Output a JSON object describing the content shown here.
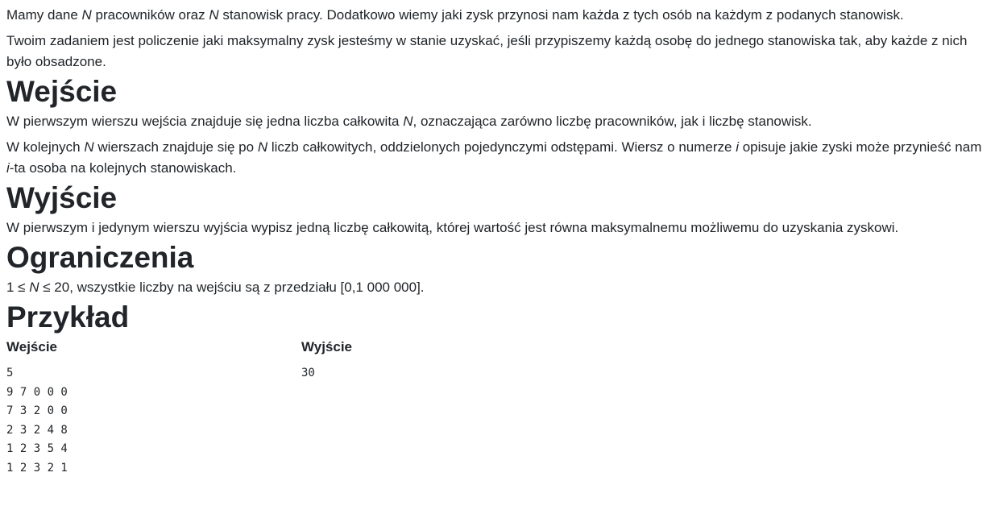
{
  "intro": {
    "p1": {
      "a": "Mamy dane ",
      "n1": "N",
      "b": " pracowników oraz ",
      "n2": "N",
      "c": " stanowisk pracy. Dodatkowo wiemy jaki zysk przynosi nam każda z tych osób na każdym z podanych stanowisk."
    },
    "p2": "Twoim zadaniem jest policzenie jaki maksymalny zysk jesteśmy w stanie uzyskać, jeśli przypiszemy każdą osobę do jednego stanowiska tak, aby każde z nich było obsadzone."
  },
  "input_section": {
    "heading": "Wejście",
    "p1": {
      "a": "W pierwszym wierszu wejścia znajduje się jedna liczba całkowita ",
      "n": "N",
      "b": ", oznaczająca zarówno liczbę pracowników, jak i liczbę stanowisk."
    },
    "p2": {
      "a": "W kolejnych ",
      "n1": "N",
      "b": " wierszach znajduje się po ",
      "n2": "N",
      "c": " liczb całkowitych, oddzielonych pojedynczymi odstępami. Wiersz o numerze ",
      "i1": "i",
      "d": " opisuje jakie zyski może przynieść nam ",
      "i2": "i",
      "e": "-ta osoba na kolejnych stanowiskach."
    }
  },
  "output_section": {
    "heading": "Wyjście",
    "p1": "W pierwszym i jedynym wierszu wyjścia wypisz jedną liczbę całkowitą, której wartość jest równa maksymalnemu możliwemu do uzyskania zyskowi."
  },
  "constraints_section": {
    "heading": "Ograniczenia",
    "a": "1 ≤ ",
    "n": "N",
    "b": " ≤ 20, wszystkie liczby na wejściu są z przedziału [0,1 000 000]."
  },
  "example_section": {
    "heading": "Przykład",
    "input_label": "Wejście",
    "output_label": "Wyjście",
    "input_text": "5\n9 7 0 0 0\n7 3 2 0 0\n2 3 2 4 8\n1 2 3 5 4\n1 2 3 2 1",
    "output_text": "30"
  }
}
